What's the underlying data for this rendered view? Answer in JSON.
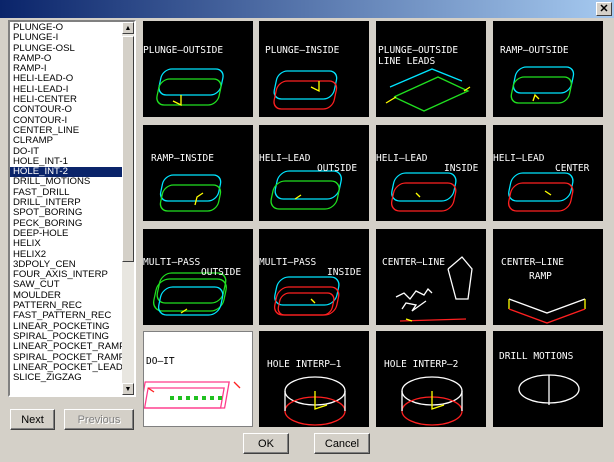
{
  "window": {
    "close_glyph": "✕"
  },
  "list": {
    "selected_index": 14,
    "items": [
      "PLUNGE-O",
      "PLUNGE-I",
      "PLUNGE-OSL",
      "RAMP-O",
      "RAMP-I",
      "HELI-LEAD-O",
      "HELI-LEAD-I",
      "HELI-CENTER",
      "CONTOUR-O",
      "CONTOUR-I",
      "CENTER_LINE",
      "CLRAMP",
      "DO-IT",
      "HOLE_INT-1",
      "HOLE_INT-2",
      "DRILL_MOTIONS",
      "FAST_DRILL",
      "DRILL_INTERP",
      "SPOT_BORING",
      "PECK_BORING",
      "DEEP-HOLE",
      "HELIX",
      "HELIX2",
      "3DPOLY_CEN",
      "FOUR_AXIS_INTERP",
      "SAW_CUT",
      "MOULDER",
      "PATTERN_REC",
      "FAST_PATTERN_REC",
      "LINEAR_POCKETING",
      "SPIRAL_POCKETING",
      "LINEAR_POCKET_RAMP",
      "SPIRAL_POCKET_RAMP",
      "LINEAR_POCKET_LEAD_I",
      "SLICE_ZIGZAG"
    ]
  },
  "buttons": {
    "next": "Next",
    "previous": "Previous",
    "ok": "OK",
    "cancel": "Cancel"
  },
  "tiles": [
    {
      "name": "plunge-outside",
      "labels": [
        "PLUNGE–OUTSIDE"
      ]
    },
    {
      "name": "plunge-inside",
      "labels": [
        "PLUNGE–INSIDE"
      ]
    },
    {
      "name": "plunge-outside-line-leads",
      "labels": [
        "PLUNGE–OUTSIDE",
        "LINE LEADS"
      ]
    },
    {
      "name": "ramp-outside",
      "labels": [
        "RAMP–OUTSIDE"
      ]
    },
    {
      "name": "ramp-inside",
      "labels": [
        "RAMP–INSIDE"
      ]
    },
    {
      "name": "heli-lead-outside",
      "labels": [
        "HELI–LEAD",
        "OUTSIDE"
      ]
    },
    {
      "name": "heli-lead-inside",
      "labels": [
        "HELI–LEAD",
        "INSIDE"
      ]
    },
    {
      "name": "heli-lead-center",
      "labels": [
        "HELI–LEAD",
        "CENTER"
      ]
    },
    {
      "name": "multi-pass-outside",
      "labels": [
        "MULTI–PASS",
        "OUTSIDE"
      ]
    },
    {
      "name": "multi-pass-inside",
      "labels": [
        "MULTI–PASS",
        "INSIDE"
      ]
    },
    {
      "name": "center-line",
      "labels": [
        "CENTER–LINE"
      ]
    },
    {
      "name": "center-line-ramp",
      "labels": [
        "CENTER–LINE",
        "RAMP"
      ]
    },
    {
      "name": "do-it",
      "labels": [
        "DO–IT"
      ]
    },
    {
      "name": "hole-interp-1",
      "labels": [
        "HOLE INTERP–1"
      ]
    },
    {
      "name": "hole-interp-2",
      "labels": [
        "HOLE INTERP–2"
      ]
    },
    {
      "name": "drill-motions",
      "labels": [
        "DRILL MOTIONS"
      ]
    }
  ],
  "colors": {
    "cyan": "#00e5ff",
    "red": "#ff2020",
    "green": "#20e020",
    "yellow": "#ffff00",
    "white": "#ffffff",
    "selection": "#0a246a"
  }
}
